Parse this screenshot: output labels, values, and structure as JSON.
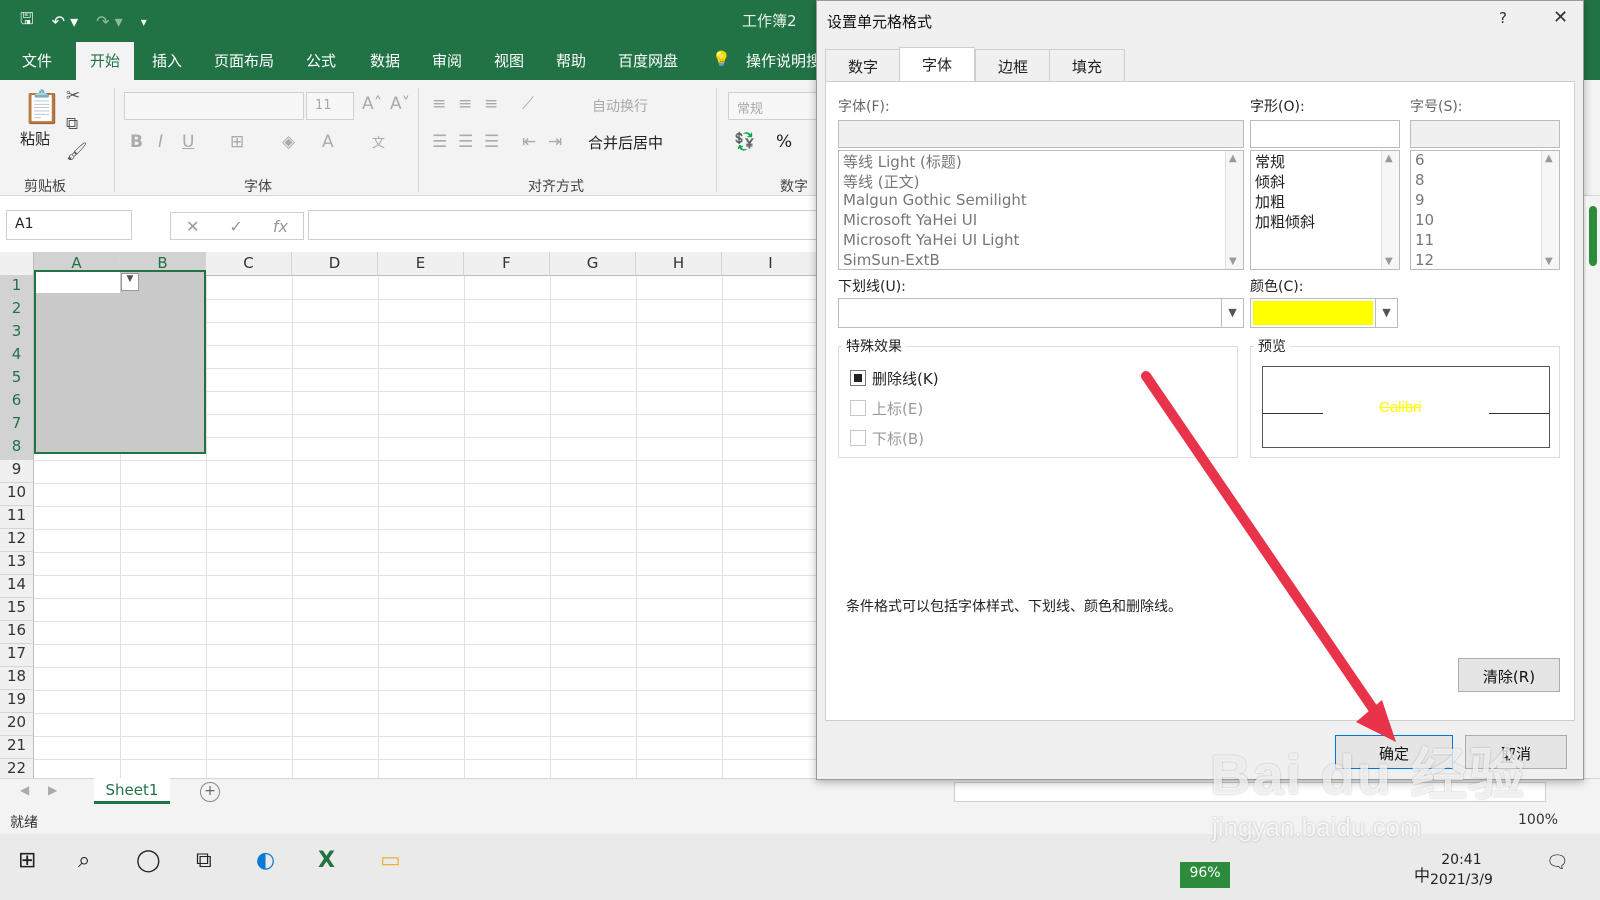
{
  "app": {
    "doc_title": "工作簿2",
    "ribbon_tabs": [
      "文件",
      "开始",
      "插入",
      "页面布局",
      "公式",
      "数据",
      "审阅",
      "视图",
      "帮助",
      "百度网盘",
      "操作说明搜"
    ],
    "active_tab": "开始",
    "groups": {
      "clipboard": "剪贴板",
      "font": "字体",
      "alignment": "对齐方式",
      "number": "数字"
    },
    "paste_label": "粘贴",
    "font_size_value": "11",
    "wrap_text": "自动换行",
    "merge_center": "合并后居中",
    "number_format": "常规",
    "percent": "%"
  },
  "formula_bar": {
    "name_box": "A1",
    "fx": "fx"
  },
  "grid": {
    "columns": [
      "A",
      "B",
      "C",
      "D",
      "E",
      "F",
      "G",
      "H",
      "I"
    ],
    "rows": [
      "1",
      "2",
      "3",
      "4",
      "5",
      "6",
      "7",
      "8",
      "9",
      "10",
      "11",
      "12",
      "13",
      "14",
      "15",
      "16",
      "17",
      "18",
      "19",
      "20",
      "21",
      "22"
    ]
  },
  "sheets": {
    "tabs": [
      "Sheet1"
    ],
    "add": "+"
  },
  "status": {
    "text": "就绪",
    "zoom": "100%"
  },
  "taskbar": {
    "battery": "96%",
    "ime": "中",
    "time": "20:41",
    "date": "2021/3/9"
  },
  "dialog": {
    "title": "设置单元格格式",
    "help": "?",
    "close": "✕",
    "tabs": [
      "数字",
      "字体",
      "边框",
      "填充"
    ],
    "active_tab": "字体",
    "font_label": "字体(F):",
    "font_input": "",
    "font_list": [
      "等线 Light (标题)",
      "等线 (正文)",
      "Malgun Gothic Semilight",
      "Microsoft YaHei UI",
      "Microsoft YaHei UI Light",
      "SimSun-ExtB"
    ],
    "style_label": "字形(O):",
    "style_list": [
      "常规",
      "倾斜",
      "加粗",
      "加粗倾斜"
    ],
    "size_label": "字号(S):",
    "size_list": [
      "6",
      "8",
      "9",
      "10",
      "11",
      "12"
    ],
    "underline_label": "下划线(U):",
    "underline_value": "",
    "color_label": "颜色(C):",
    "color_value": "#FFFF00",
    "effects_legend": "特殊效果",
    "effects": [
      {
        "label": "删除线(K)",
        "checked": true,
        "enabled": true
      },
      {
        "label": "上标(E)",
        "checked": false,
        "enabled": false
      },
      {
        "label": "下标(B)",
        "checked": false,
        "enabled": false
      }
    ],
    "preview_legend": "预览",
    "preview_text": "Calibri",
    "note": "条件格式可以包括字体样式、下划线、颜色和删除线。",
    "clear_button": "清除(R)",
    "ok_button": "确定",
    "cancel_button": "取消"
  },
  "watermark": {
    "brand": "Bai du 经验",
    "url": "jingyan.baidu.com"
  },
  "colors": {
    "excel_green": "#217346",
    "arrow_red": "#e8334a",
    "font_color": "#FFFF00"
  }
}
